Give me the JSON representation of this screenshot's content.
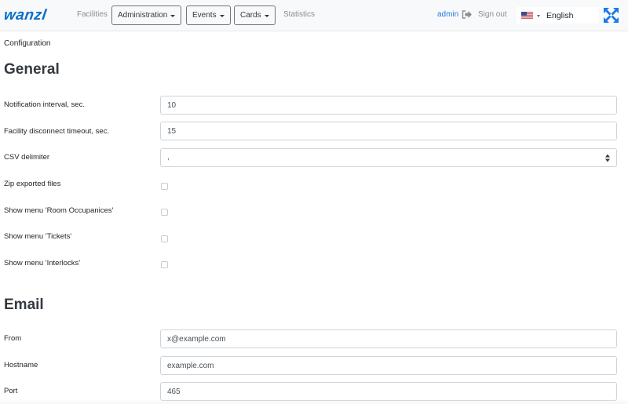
{
  "navbar": {
    "brand": "wanzl",
    "links": {
      "facilities": "Facilities",
      "statistics": "Statistics"
    },
    "dropdowns": {
      "administration": "Administration",
      "events": "Events",
      "cards": "Cards"
    },
    "user": "admin",
    "sign_out": "Sign out",
    "language": {
      "selected": "English",
      "flag": "us-flag-icon"
    },
    "expand_icon": "expand-arrows-icon",
    "colors": {
      "brand": "#0a6fc8",
      "link": "#2a79e0"
    }
  },
  "breadcrumb": "Configuration",
  "sections": {
    "general": {
      "title": "General",
      "fields": {
        "notification_interval": {
          "label": "Notification interval, sec.",
          "value": "10"
        },
        "disconnect_timeout": {
          "label": "Facility disconnect timeout, sec.",
          "value": "15"
        },
        "csv_delimiter": {
          "label": "CSV delimiter",
          "value": ","
        },
        "zip_exported": {
          "label": "Zip exported files",
          "checked": false
        },
        "show_room_occupancies": {
          "label": "Show menu 'Room Occupanices'",
          "checked": false
        },
        "show_tickets": {
          "label": "Show menu 'Tickets'",
          "checked": false
        },
        "show_interlocks": {
          "label": "Show menu 'Interlocks'",
          "checked": false
        }
      }
    },
    "email": {
      "title": "Email",
      "fields": {
        "from": {
          "label": "From",
          "value": "x@example.com"
        },
        "hostname": {
          "label": "Hostname",
          "value": "example.com"
        },
        "port": {
          "label": "Port",
          "value": "465"
        }
      }
    }
  }
}
